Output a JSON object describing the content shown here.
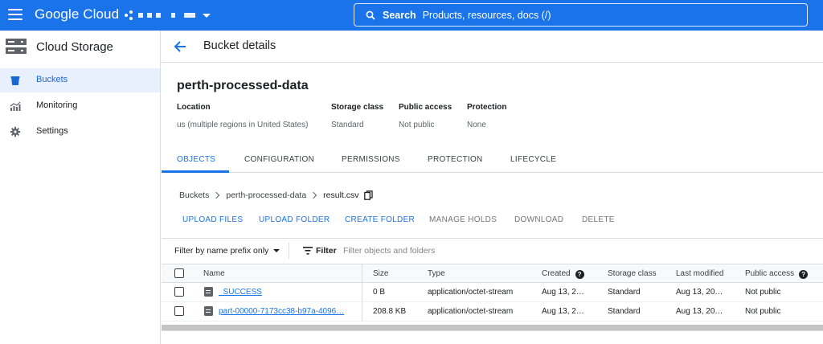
{
  "topbar": {
    "brand": "Google Cloud",
    "search_label": "Search",
    "search_placeholder": "Products, resources, docs (/)",
    "colors": {
      "bar": "#1a73e8"
    }
  },
  "sidebar": {
    "product": "Cloud Storage",
    "items": [
      {
        "label": "Buckets",
        "icon": "bucket-icon",
        "active": true
      },
      {
        "label": "Monitoring",
        "icon": "monitoring-chart-icon",
        "active": false
      },
      {
        "label": "Settings",
        "icon": "gear-icon",
        "active": false
      }
    ]
  },
  "header": {
    "title": "Bucket details"
  },
  "bucket": {
    "name": "perth-processed-data",
    "meta": [
      {
        "key": "Location",
        "value": "us (multiple regions in United States)"
      },
      {
        "key": "Storage class",
        "value": "Standard"
      },
      {
        "key": "Public access",
        "value": "Not public"
      },
      {
        "key": "Protection",
        "value": "None"
      }
    ]
  },
  "tabs": [
    "OBJECTS",
    "CONFIGURATION",
    "PERMISSIONS",
    "PROTECTION",
    "LIFECYCLE"
  ],
  "breadcrumb": {
    "root": "Buckets",
    "bucket": "perth-processed-data",
    "current": "result.csv"
  },
  "actions": {
    "upload_files": "UPLOAD FILES",
    "upload_folder": "UPLOAD FOLDER",
    "create_folder": "CREATE FOLDER",
    "manage_holds": "MANAGE HOLDS",
    "download": "DOWNLOAD",
    "delete": "DELETE"
  },
  "filter": {
    "prefix_label": "Filter by name prefix only",
    "filter_label": "Filter",
    "placeholder": "Filter objects and folders"
  },
  "table": {
    "columns": [
      "Name",
      "Size",
      "Type",
      "Created",
      "Storage class",
      "Last modified",
      "Public access"
    ],
    "rows": [
      {
        "name": "_SUCCESS",
        "size": "0 B",
        "type": "application/octet-stream",
        "created": "Aug 13, 2…",
        "storage_class": "Standard",
        "modified": "Aug 13, 20…",
        "public": "Not public"
      },
      {
        "name": "part-00000-7173cc38-b97a-4096…",
        "size": "208.8 KB",
        "type": "application/octet-stream",
        "created": "Aug 13, 2…",
        "storage_class": "Standard",
        "modified": "Aug 13, 20…",
        "public": "Not public"
      }
    ]
  }
}
